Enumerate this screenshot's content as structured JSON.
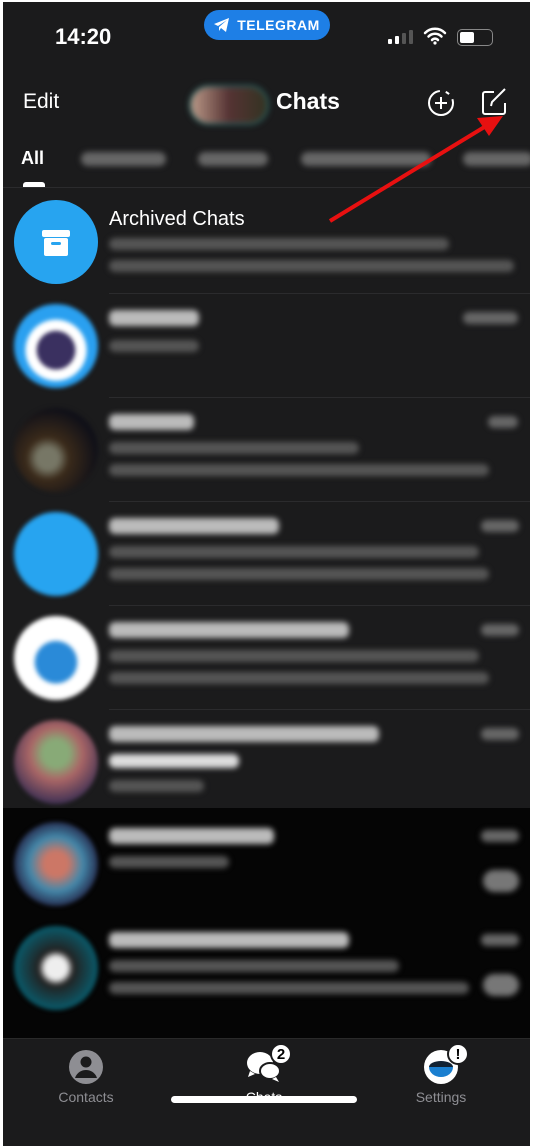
{
  "status": {
    "time": "14:20",
    "pill": "TELEGRAM"
  },
  "header": {
    "edit": "Edit",
    "title": "Chats"
  },
  "tabs": {
    "active": "All"
  },
  "archived": {
    "name": "Archived Chats"
  },
  "tabbar": {
    "items": [
      {
        "label": "Contacts"
      },
      {
        "label": "Chats",
        "badge": "2"
      },
      {
        "label": "Settings",
        "badge": "!"
      }
    ]
  },
  "colors": {
    "accent": "#1e7fe6",
    "background": "#1b1b1c",
    "annotation_arrow": "#e81010"
  }
}
